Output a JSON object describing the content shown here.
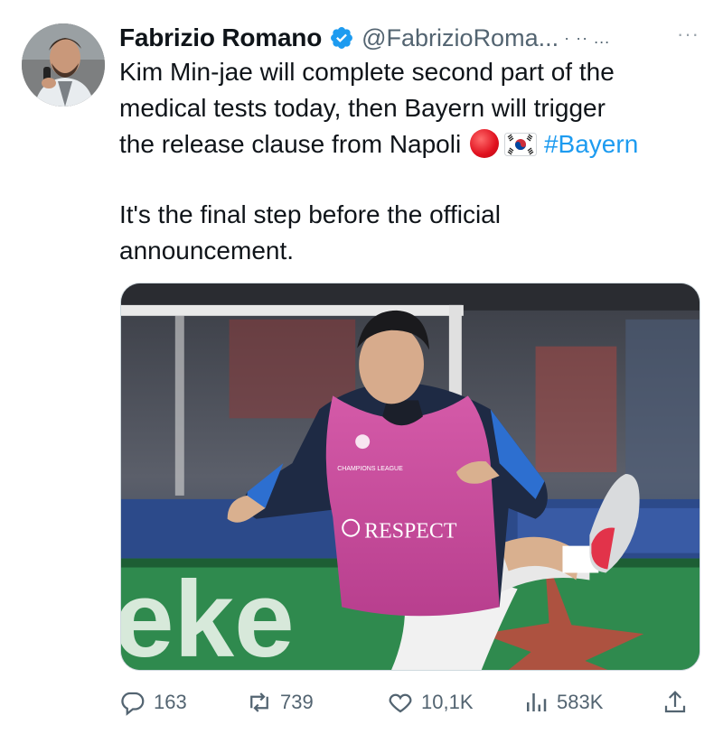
{
  "author": {
    "display_name": "Fabrizio Romano",
    "handle": "@FabrizioRoma...",
    "header_meta": "· ·· ...",
    "verified_icon": "verified-badge-icon",
    "more_icon": "more-icon",
    "more_label": "···"
  },
  "tweet": {
    "line1": "Kim Min-jae will complete second part of the",
    "line2": "medical tests today, then Bayern will trigger",
    "line3": "the release clause from Napoli",
    "hashtag": "#Bayern",
    "para2_line1": "It's the final step before the official",
    "para2_line2": "announcement.",
    "emojis": [
      "red-circle-emoji",
      "south-korea-flag-emoji"
    ]
  },
  "media": {
    "bib_text": "RESPECT",
    "bib_badge": "CHAMPIONS LEAGUE",
    "ad_board_text": "eke"
  },
  "actions": {
    "replies": "163",
    "reposts": "739",
    "likes": "10,1K",
    "views": "583K"
  },
  "colors": {
    "accent": "#1d9bf0",
    "text": "#0f1419",
    "muted": "#536471"
  }
}
